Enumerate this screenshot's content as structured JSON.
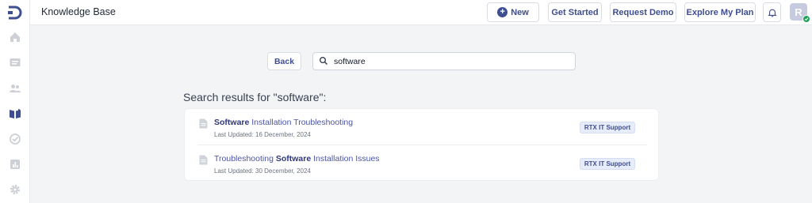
{
  "header": {
    "title": "Knowledge Base",
    "new_label": "New",
    "get_started_label": "Get Started",
    "request_demo_label": "Request Demo",
    "explore_plan_label": "Explore My Plan",
    "avatar_initial": "R"
  },
  "sidebar": {
    "items": [
      {
        "icon": "home-icon"
      },
      {
        "icon": "tickets-icon"
      },
      {
        "icon": "users-icon"
      },
      {
        "icon": "knowledge-base-icon",
        "active": true
      },
      {
        "icon": "check-circle-icon"
      },
      {
        "icon": "reports-icon"
      },
      {
        "icon": "settings-icon"
      }
    ]
  },
  "search": {
    "back_label": "Back",
    "query": "software"
  },
  "results": {
    "heading": "Search results for \"software\":",
    "items": [
      {
        "title_parts": [
          "Software",
          " Installation Troubleshooting"
        ],
        "updated": "Last Updated: 16 December, 2024",
        "tag": "RTX IT Support"
      },
      {
        "title_parts": [
          "Troubleshooting ",
          "Software",
          " Installation Issues"
        ],
        "updated": "Last Updated: 30 December, 2024",
        "tag": "RTX IT Support"
      }
    ]
  },
  "colors": {
    "accent": "#3f4e8f",
    "status_online": "#22a35a"
  }
}
